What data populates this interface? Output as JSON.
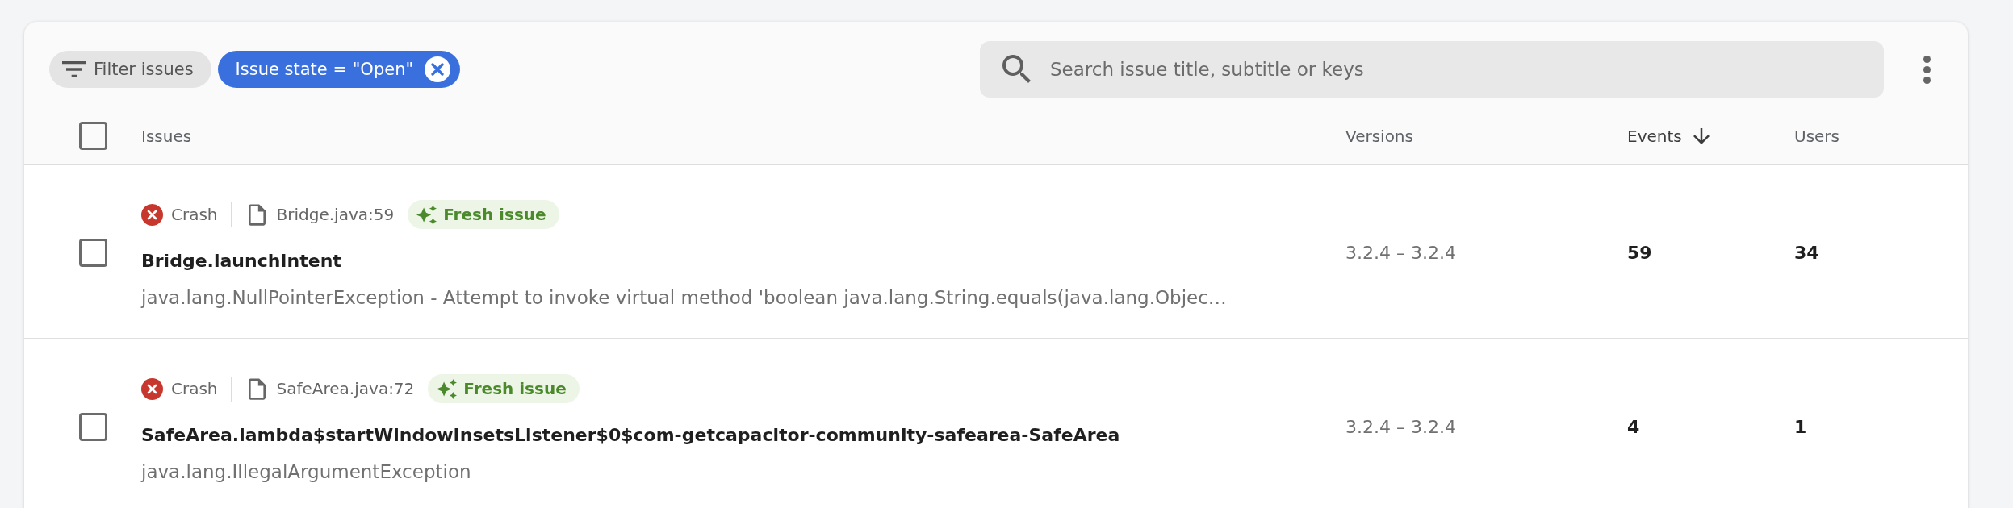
{
  "toolbar": {
    "filter_button": {
      "label": "Filter issues"
    },
    "active_filters": [
      {
        "label": "Issue state = \"Open\""
      }
    ],
    "search": {
      "placeholder": "Search issue title, subtitle or keys"
    }
  },
  "table": {
    "select_all": {
      "checked": false
    },
    "columns": [
      {
        "label": "Issues",
        "sorted": false
      },
      {
        "label": "Versions",
        "sorted": false
      },
      {
        "label": "Events",
        "sorted": true
      },
      {
        "label": "Users",
        "sorted": false
      }
    ],
    "rows": [
      {
        "checked": false,
        "kind": "crash",
        "type_label": "Crash",
        "file": "Bridge.java:59",
        "badge": "Fresh issue",
        "title": "Bridge.launchIntent",
        "subtitle": "java.lang.NullPointerException - Attempt to invoke virtual method 'boolean java.lang.String.equals(java.lang.Objec…",
        "versions": "3.2.4 – 3.2.4",
        "events": "59",
        "users": "34"
      },
      {
        "checked": false,
        "kind": "crash",
        "type_label": "Crash",
        "file": "SafeArea.java:72",
        "badge": "Fresh issue",
        "title": "SafeArea.lambda$startWindowInsetsListener$0$com-getcapacitor-community-safearea-SafeArea",
        "subtitle": "java.lang.IllegalArgumentException",
        "versions": "3.2.4 – 3.2.4",
        "events": "4",
        "users": "1"
      }
    ]
  }
}
